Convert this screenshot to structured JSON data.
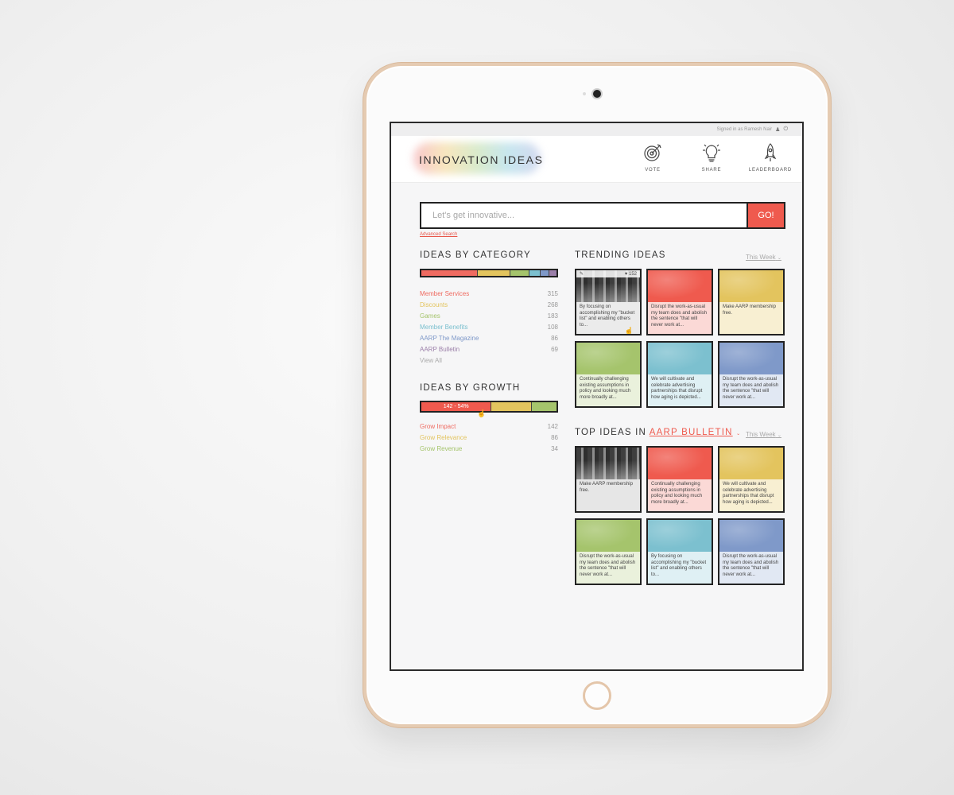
{
  "topbar": {
    "signed_in": "Signed in as Ramesh Nair"
  },
  "header": {
    "logo": "INNOVATION IDEAS"
  },
  "nav": [
    {
      "label": "VOTE",
      "icon": "target-icon"
    },
    {
      "label": "SHARE",
      "icon": "lightbulb-icon"
    },
    {
      "label": "LEADERBOARD",
      "icon": "rocket-icon"
    }
  ],
  "search": {
    "placeholder": "Let's get innovative...",
    "button": "GO!",
    "advanced": "Advanced Search"
  },
  "category": {
    "title": "IDEAS BY CATEGORY",
    "items": [
      {
        "label": "Member Services",
        "count": "315",
        "color": "#ef6b61"
      },
      {
        "label": "Discounts",
        "count": "268",
        "color": "#e3c45e"
      },
      {
        "label": "Games",
        "count": "183",
        "color": "#a5c46c"
      },
      {
        "label": "Member Benefits",
        "count": "108",
        "color": "#7cc0cf"
      },
      {
        "label": "AARP The Magazine",
        "count": "86",
        "color": "#7f99c9"
      },
      {
        "label": "AARP Bulletin",
        "count": "69",
        "color": "#9b7fa9"
      }
    ],
    "view_all": "View All"
  },
  "growth": {
    "title": "IDEAS BY GROWTH",
    "bar_label": "142 - 54%",
    "items": [
      {
        "label": "Grow Impact",
        "count": "142",
        "color": "#ef6b61"
      },
      {
        "label": "Grow Relevance",
        "count": "86",
        "color": "#e3c45e"
      },
      {
        "label": "Grow Revenue",
        "count": "34",
        "color": "#a5c46c"
      }
    ]
  },
  "trending": {
    "title": "TRENDING IDEAS",
    "filter": "This Week",
    "cards": [
      {
        "text": "By focusing on accomplishing my \"bucket list\" and enabling others to...",
        "color": "photo",
        "tint": "#ebebeb",
        "likes": "152"
      },
      {
        "text": "Disrupt the work-as-usual my team does and abolish the sentence \"that will never work at...",
        "color": "#ef5a4e",
        "tint": "#fbd9d6"
      },
      {
        "text": "Make AARP membership free.",
        "color": "#e3c45e",
        "tint": "#f8efd2"
      },
      {
        "text": "Continually challenging existing assumptions in policy and looking much more broadly at...",
        "color": "#a5c46c",
        "tint": "#eaf1dc"
      },
      {
        "text": "We will cultivate and celebrate advertising partnerships that disrupt how aging is depicted...",
        "color": "#7cc0cf",
        "tint": "#dff0f4"
      },
      {
        "text": "Disrupt the work-as-usual my team does and abolish the sentence \"that will never work at...",
        "color": "#7f99c9",
        "tint": "#e1e8f3"
      }
    ]
  },
  "top": {
    "title_prefix": "TOP IDEAS IN",
    "category": "AARP BULLETIN",
    "filter": "This Week",
    "cards": [
      {
        "text": "Make AARP membership free.",
        "color": "photo",
        "tint": "#e6e6e6"
      },
      {
        "text": "Continually challenging existing assumptions in policy and looking much more broadly at...",
        "color": "#ef5a4e",
        "tint": "#fbd9d6"
      },
      {
        "text": "We will cultivate and celebrate advertising partnerships that disrupt how aging is depicted...",
        "color": "#e3c45e",
        "tint": "#f8efd2"
      },
      {
        "text": "Disrupt the work-as-usual my team does and abolish the sentence \"that will never work at...",
        "color": "#a5c46c",
        "tint": "#eaf1dc"
      },
      {
        "text": "By focusing on accomplishing my \"bucket list\" and enabling others to...",
        "color": "#7cc0cf",
        "tint": "#dff0f4"
      },
      {
        "text": "Disrupt the work-as-usual my team does and abolish the sentence \"that will never work at...",
        "color": "#7f99c9",
        "tint": "#e1e8f3"
      }
    ]
  }
}
